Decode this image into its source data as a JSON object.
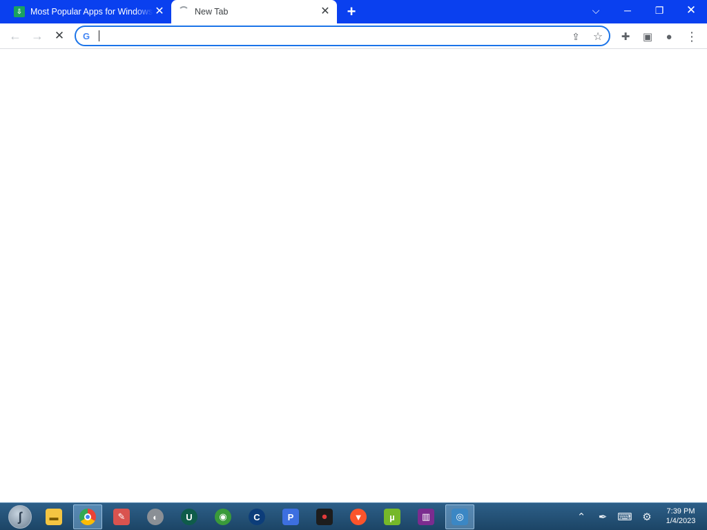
{
  "tabs": [
    {
      "title": "Most Popular Apps for Windows",
      "favicon": "download-site-icon",
      "active": false
    },
    {
      "title": "New Tab",
      "favicon": "loading-spinner-icon",
      "active": true
    }
  ],
  "omnibox": {
    "value": "",
    "placeholder": ""
  },
  "taskbar": {
    "apps": [
      "start-orb",
      "file-explorer",
      "chrome",
      "ccleaner",
      "app-generic",
      "ultraviewer",
      "internet-download-manager",
      "ccleaner-c",
      "proton-p",
      "screen-recorder",
      "brave",
      "utorrent",
      "winrar",
      "network-tool"
    ]
  },
  "clock": {
    "time": "7:39 PM",
    "date": "1/4/2023"
  },
  "colors": {
    "titlebar": "#0a40ef",
    "accent": "#1a73e8"
  }
}
